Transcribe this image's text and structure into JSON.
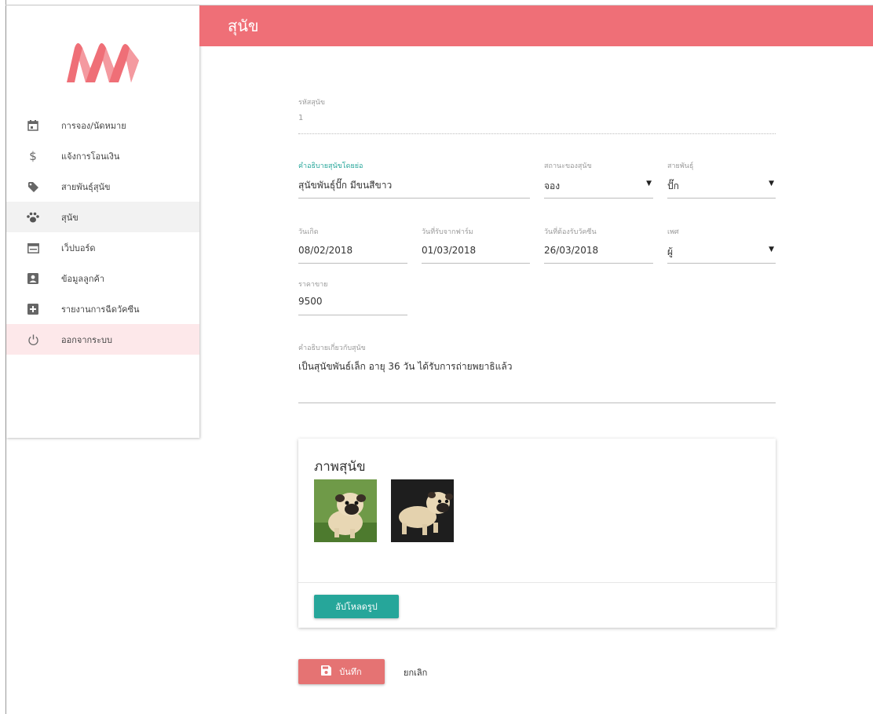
{
  "header": {
    "title": "สุนัข"
  },
  "sidebar": {
    "items": [
      {
        "label": "การจอง/นัดหมาย",
        "icon": "calendar-icon"
      },
      {
        "label": "แจ้งการโอนเงิน",
        "icon": "dollar-icon"
      },
      {
        "label": "สายพันธุ์สุนัข",
        "icon": "tag-icon"
      },
      {
        "label": "สุนัข",
        "icon": "paw-icon"
      },
      {
        "label": "เว็ปบอร์ด",
        "icon": "web-icon"
      },
      {
        "label": "ข้อมูลลูกค้า",
        "icon": "account-box-icon"
      },
      {
        "label": "รายงานการฉีดวัคซีน",
        "icon": "plus-box-icon"
      },
      {
        "label": "ออกจากระบบ",
        "icon": "power-icon"
      }
    ],
    "active_index": 3
  },
  "form": {
    "dog_id": {
      "label": "รหัสสุนัข",
      "value": "1"
    },
    "short_desc": {
      "label": "คำอธิบายสุนัขโดยย่อ",
      "value": "สุนัขพันธุ์ปั๊ก มีขนสีขาว"
    },
    "status": {
      "label": "สถานะของสุนัข",
      "value": "จอง"
    },
    "breed": {
      "label": "สายพันธุ์",
      "value": "ปั๊ก"
    },
    "birth_date": {
      "label": "วันเกิด",
      "value": "08/02/2018"
    },
    "farm_date": {
      "label": "วันที่รับจากฟาร์ม",
      "value": "01/03/2018"
    },
    "vaccine_date": {
      "label": "วันที่ต้องรับวัคซีน",
      "value": "26/03/2018"
    },
    "sex": {
      "label": "เพศ",
      "value": "ผู้"
    },
    "price": {
      "label": "ราคาขาย",
      "value": "9500"
    },
    "description": {
      "label": "คำอธิบายเกี่ยวกับสุนัข",
      "value": "เป็นสุนัขพันธ์เล็ก อายุ 36 วัน ได้รับการถ่ายพยาธิแล้ว"
    }
  },
  "photos": {
    "title": "ภาพสุนัข",
    "upload_label": "อัปโหลดรูป"
  },
  "actions": {
    "save_label": "บันทึก",
    "cancel_label": "ยกเลิก"
  },
  "colors": {
    "primary": "#ef6f77",
    "accent": "#26a69a",
    "save": "#e57373"
  }
}
